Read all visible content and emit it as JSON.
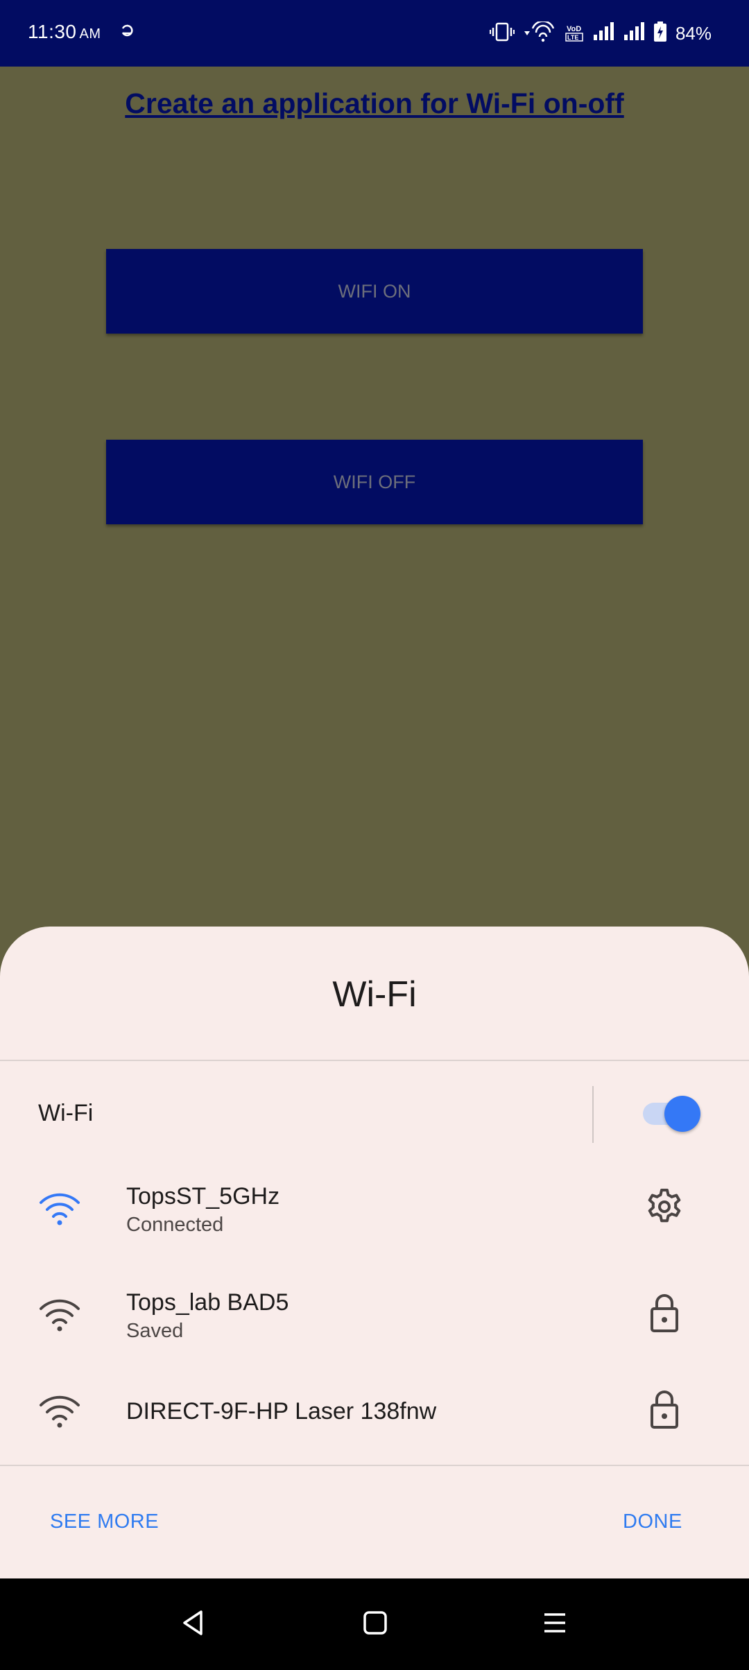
{
  "status_bar": {
    "time": "11:30",
    "ampm": "AM",
    "left_icons": [
      "data-saver-icon"
    ],
    "right_icons": [
      "vibrate-icon",
      "wifi-icon",
      "volte-icon",
      "signal-icon",
      "signal-icon",
      "battery-charging-icon"
    ],
    "volte_text": "Vo\nLTE",
    "battery": "84%"
  },
  "app": {
    "title": "Create an application for Wi-Fi on-off",
    "wifi_on_label": "WIFI ON",
    "wifi_off_label": "WIFI OFF"
  },
  "sheet": {
    "title": "Wi-Fi",
    "toggle_label": "Wi-Fi",
    "toggle_on": true,
    "networks": [
      {
        "name": "TopsST_5GHz",
        "status": "Connected",
        "icon": "wifi-signal-icon",
        "action_icon": "settings-gear-icon",
        "color": "#3478f6"
      },
      {
        "name": "Tops_lab BAD5",
        "status": "Saved",
        "icon": "wifi-signal-icon",
        "action_icon": "lock-icon",
        "color": "#4a4443"
      },
      {
        "name": "DIRECT-9F-HP Laser 138fnw",
        "status": "",
        "icon": "wifi-signal-icon",
        "action_icon": "lock-icon",
        "color": "#4a4443"
      }
    ],
    "see_more": "SEE MORE",
    "done": "DONE"
  },
  "colors": {
    "status_bar": "#020c62",
    "app_background": "#626040",
    "button": "#020c62",
    "accent": "#3478f6",
    "sheet_background": "#f9ecea"
  }
}
